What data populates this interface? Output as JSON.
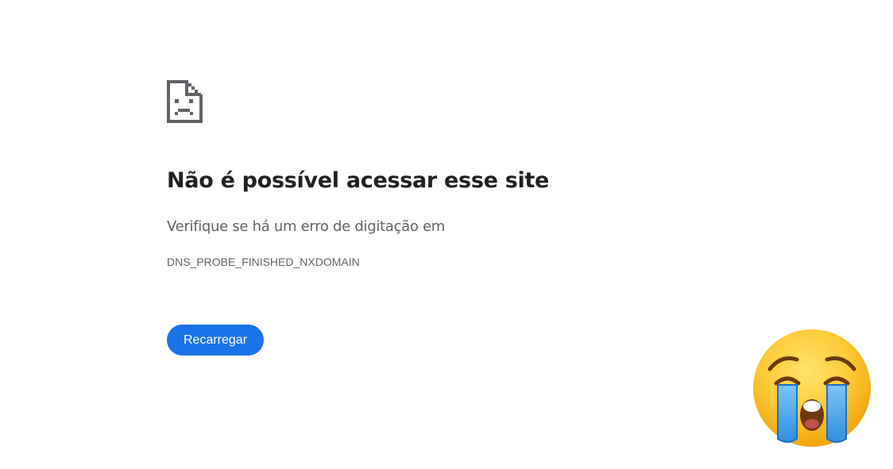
{
  "error_page": {
    "icon": "sad-document-icon",
    "title": "Não é possível acessar esse site",
    "subtitle": "Verifique se há um erro de digitação em",
    "error_code": "DNS_PROBE_FINISHED_NXDOMAIN",
    "reload_button_label": "Recarregar"
  },
  "overlay": {
    "emoji": "loudly-crying-face-icon"
  },
  "colors": {
    "background": "#ffffff",
    "title": "#202124",
    "secondary_text": "#5f6368",
    "button_bg": "#1a73e8",
    "button_text": "#ffffff",
    "icon": "#5f6368"
  }
}
